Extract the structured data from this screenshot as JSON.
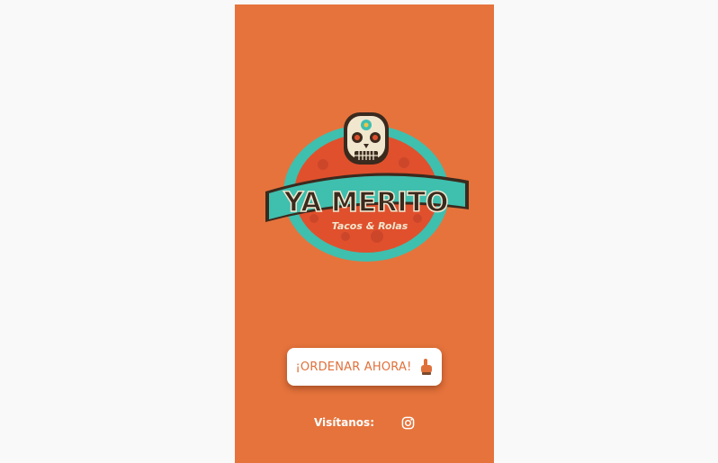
{
  "brand": {
    "name": "YA MERITO",
    "tagline": "Tacos & Rolas"
  },
  "cta": {
    "label": "¡ORDENAR AHORA!",
    "icon": "pointing-hand-icon"
  },
  "footer": {
    "visit_label": "Visítanos:",
    "social_icon": "instagram-icon"
  },
  "colors": {
    "page_background": "#f9f9f9",
    "panel_background": "#e6733c",
    "button_background": "#ffffff",
    "button_text": "#e0703a",
    "logo_teal": "#3fbfae",
    "logo_red": "#e0502d",
    "logo_dark": "#3b2a1e"
  }
}
